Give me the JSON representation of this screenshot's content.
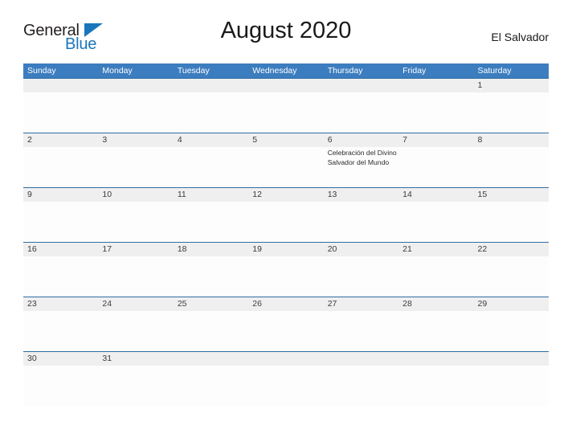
{
  "brand": {
    "name_part1": "General",
    "name_part2": "Blue",
    "triangle_icon": "blue-triangle-icon",
    "color_dark": "#231f20",
    "color_blue": "#1b75bb"
  },
  "header": {
    "title": "August 2020",
    "country": "El Salvador"
  },
  "colors": {
    "header_blue": "#3c7dbf",
    "row_divider_blue": "#2e6da4",
    "daynum_band": "#efefef",
    "text_dark": "#1a1a1a",
    "cell_background": "#fdfdfd"
  },
  "calendar": {
    "month": "August",
    "year": "2020",
    "weekdays": [
      "Sunday",
      "Monday",
      "Tuesday",
      "Wednesday",
      "Thursday",
      "Friday",
      "Saturday"
    ],
    "weeks": [
      {
        "days": [
          {
            "number": "",
            "event": ""
          },
          {
            "number": "",
            "event": ""
          },
          {
            "number": "",
            "event": ""
          },
          {
            "number": "",
            "event": ""
          },
          {
            "number": "",
            "event": ""
          },
          {
            "number": "",
            "event": ""
          },
          {
            "number": "1",
            "event": ""
          }
        ]
      },
      {
        "days": [
          {
            "number": "2",
            "event": ""
          },
          {
            "number": "3",
            "event": ""
          },
          {
            "number": "4",
            "event": ""
          },
          {
            "number": "5",
            "event": ""
          },
          {
            "number": "6",
            "event": "Celebración del Divino Salvador del Mundo"
          },
          {
            "number": "7",
            "event": ""
          },
          {
            "number": "8",
            "event": ""
          }
        ]
      },
      {
        "days": [
          {
            "number": "9",
            "event": ""
          },
          {
            "number": "10",
            "event": ""
          },
          {
            "number": "11",
            "event": ""
          },
          {
            "number": "12",
            "event": ""
          },
          {
            "number": "13",
            "event": ""
          },
          {
            "number": "14",
            "event": ""
          },
          {
            "number": "15",
            "event": ""
          }
        ]
      },
      {
        "days": [
          {
            "number": "16",
            "event": ""
          },
          {
            "number": "17",
            "event": ""
          },
          {
            "number": "18",
            "event": ""
          },
          {
            "number": "19",
            "event": ""
          },
          {
            "number": "20",
            "event": ""
          },
          {
            "number": "21",
            "event": ""
          },
          {
            "number": "22",
            "event": ""
          }
        ]
      },
      {
        "days": [
          {
            "number": "23",
            "event": ""
          },
          {
            "number": "24",
            "event": ""
          },
          {
            "number": "25",
            "event": ""
          },
          {
            "number": "26",
            "event": ""
          },
          {
            "number": "27",
            "event": ""
          },
          {
            "number": "28",
            "event": ""
          },
          {
            "number": "29",
            "event": ""
          }
        ]
      },
      {
        "days": [
          {
            "number": "30",
            "event": ""
          },
          {
            "number": "31",
            "event": ""
          },
          {
            "number": "",
            "event": ""
          },
          {
            "number": "",
            "event": ""
          },
          {
            "number": "",
            "event": ""
          },
          {
            "number": "",
            "event": ""
          },
          {
            "number": "",
            "event": ""
          }
        ]
      }
    ]
  }
}
